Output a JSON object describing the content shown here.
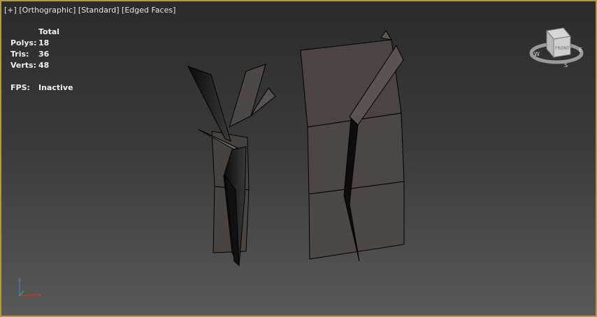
{
  "viewport": {
    "label_parts": [
      "[+]",
      "[Orthographic]",
      "[Standard]",
      "[Edged Faces]"
    ]
  },
  "stats": {
    "header": "Total",
    "polys_label": "Polys:",
    "polys_value": "18",
    "tris_label": "Tris:",
    "tris_value": "36",
    "verts_label": "Verts:",
    "verts_value": "48",
    "fps_label": "FPS:",
    "fps_value": "Inactive"
  },
  "viewcube": {
    "face_label": "FRONT",
    "compass": [
      "W",
      "E",
      "S"
    ]
  },
  "axis": {
    "labels": [
      "z",
      "x"
    ]
  },
  "colors": {
    "border": "#b39a3c",
    "mesh_face": "#4b4442",
    "mesh_edge": "#000000"
  }
}
